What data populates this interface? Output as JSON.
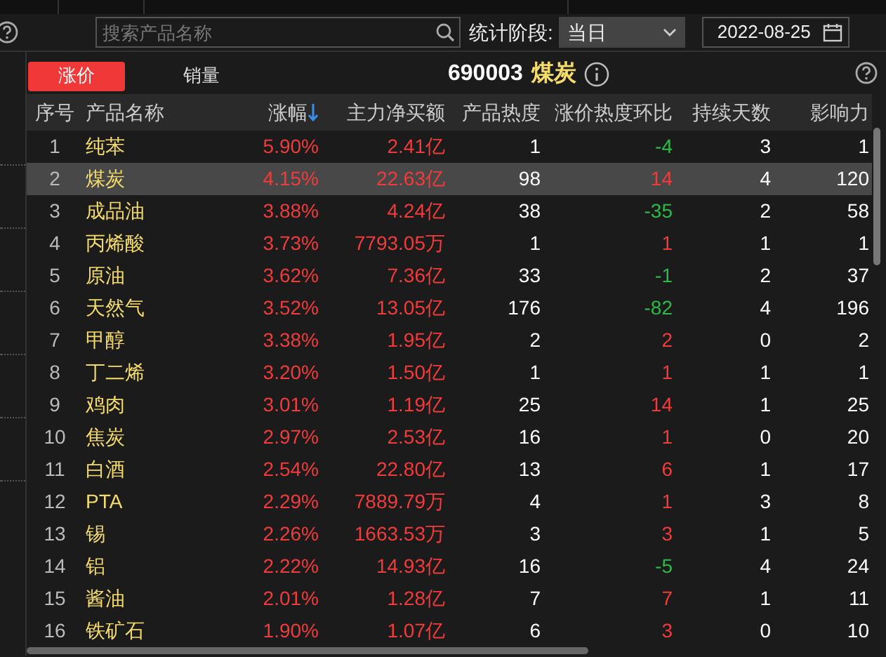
{
  "toolbar": {
    "search": {
      "placeholder": "搜索产品名称"
    },
    "period_label": "统计阶段:",
    "period": "当日",
    "date": "2022-08-25"
  },
  "tabs": [
    {
      "label": "涨价",
      "selected": true
    },
    {
      "label": "销量",
      "selected": false
    }
  ],
  "title": {
    "code": "690003",
    "name": "煤炭"
  },
  "table": {
    "columns": [
      {
        "label": "序号",
        "sorted": false
      },
      {
        "label": "产品名称",
        "sorted": false
      },
      {
        "label": "涨幅",
        "sorted": true
      },
      {
        "label": "主力净买额",
        "sorted": false
      },
      {
        "label": "产品热度",
        "sorted": false
      },
      {
        "label": "涨价热度环比",
        "sorted": false
      },
      {
        "label": "持续天数",
        "sorted": false
      },
      {
        "label": "影响力",
        "sorted": false
      }
    ],
    "rows": [
      {
        "index": "1",
        "name": "纯苯",
        "change": "5.90%",
        "net_buy": "2.41亿",
        "heat": "1",
        "heat_change": "-4",
        "color": "#2cbb4a",
        "days": "3",
        "impact": "1",
        "selected": false
      },
      {
        "index": "2",
        "name": "煤炭",
        "change": "4.15%",
        "net_buy": "22.63亿",
        "heat": "98",
        "heat_change": "14",
        "color": "#f23b3b",
        "days": "4",
        "impact": "120",
        "selected": true
      },
      {
        "index": "3",
        "name": "成品油",
        "change": "3.88%",
        "net_buy": "4.24亿",
        "heat": "38",
        "heat_change": "-35",
        "color": "#2cbb4a",
        "days": "2",
        "impact": "58",
        "selected": false
      },
      {
        "index": "4",
        "name": "丙烯酸",
        "change": "3.73%",
        "net_buy": "7793.05万",
        "heat": "1",
        "heat_change": "1",
        "color": "#f23b3b",
        "days": "1",
        "impact": "1",
        "selected": false
      },
      {
        "index": "5",
        "name": "原油",
        "change": "3.62%",
        "net_buy": "7.36亿",
        "heat": "33",
        "heat_change": "-1",
        "color": "#2cbb4a",
        "days": "2",
        "impact": "37",
        "selected": false
      },
      {
        "index": "6",
        "name": "天然气",
        "change": "3.52%",
        "net_buy": "13.05亿",
        "heat": "176",
        "heat_change": "-82",
        "color": "#2cbb4a",
        "days": "4",
        "impact": "196",
        "selected": false
      },
      {
        "index": "7",
        "name": "甲醇",
        "change": "3.38%",
        "net_buy": "1.95亿",
        "heat": "2",
        "heat_change": "2",
        "color": "#f23b3b",
        "days": "0",
        "impact": "2",
        "selected": false
      },
      {
        "index": "8",
        "name": "丁二烯",
        "change": "3.20%",
        "net_buy": "1.50亿",
        "heat": "1",
        "heat_change": "1",
        "color": "#f23b3b",
        "days": "1",
        "impact": "1",
        "selected": false
      },
      {
        "index": "9",
        "name": "鸡肉",
        "change": "3.01%",
        "net_buy": "1.19亿",
        "heat": "25",
        "heat_change": "14",
        "color": "#f23b3b",
        "days": "1",
        "impact": "25",
        "selected": false
      },
      {
        "index": "10",
        "name": "焦炭",
        "change": "2.97%",
        "net_buy": "2.53亿",
        "heat": "16",
        "heat_change": "1",
        "color": "#f23b3b",
        "days": "0",
        "impact": "20",
        "selected": false
      },
      {
        "index": "11",
        "name": "白酒",
        "change": "2.54%",
        "net_buy": "22.80亿",
        "heat": "13",
        "heat_change": "6",
        "color": "#f23b3b",
        "days": "1",
        "impact": "17",
        "selected": false
      },
      {
        "index": "12",
        "name": "PTA",
        "change": "2.29%",
        "net_buy": "7889.79万",
        "heat": "4",
        "heat_change": "1",
        "color": "#f23b3b",
        "days": "3",
        "impact": "8",
        "selected": false
      },
      {
        "index": "13",
        "name": "锡",
        "change": "2.26%",
        "net_buy": "1663.53万",
        "heat": "3",
        "heat_change": "3",
        "color": "#f23b3b",
        "days": "1",
        "impact": "5",
        "selected": false
      },
      {
        "index": "14",
        "name": "铝",
        "change": "2.22%",
        "net_buy": "14.93亿",
        "heat": "16",
        "heat_change": "-5",
        "color": "#2cbb4a",
        "days": "4",
        "impact": "24",
        "selected": false
      },
      {
        "index": "15",
        "name": "酱油",
        "change": "2.01%",
        "net_buy": "1.28亿",
        "heat": "7",
        "heat_change": "7",
        "color": "#f23b3b",
        "days": "1",
        "impact": "11",
        "selected": false
      },
      {
        "index": "16",
        "name": "铁矿石",
        "change": "1.90%",
        "net_buy": "1.07亿",
        "heat": "6",
        "heat_change": "3",
        "color": "#f23b3b",
        "days": "0",
        "impact": "10",
        "selected": false
      }
    ]
  }
}
